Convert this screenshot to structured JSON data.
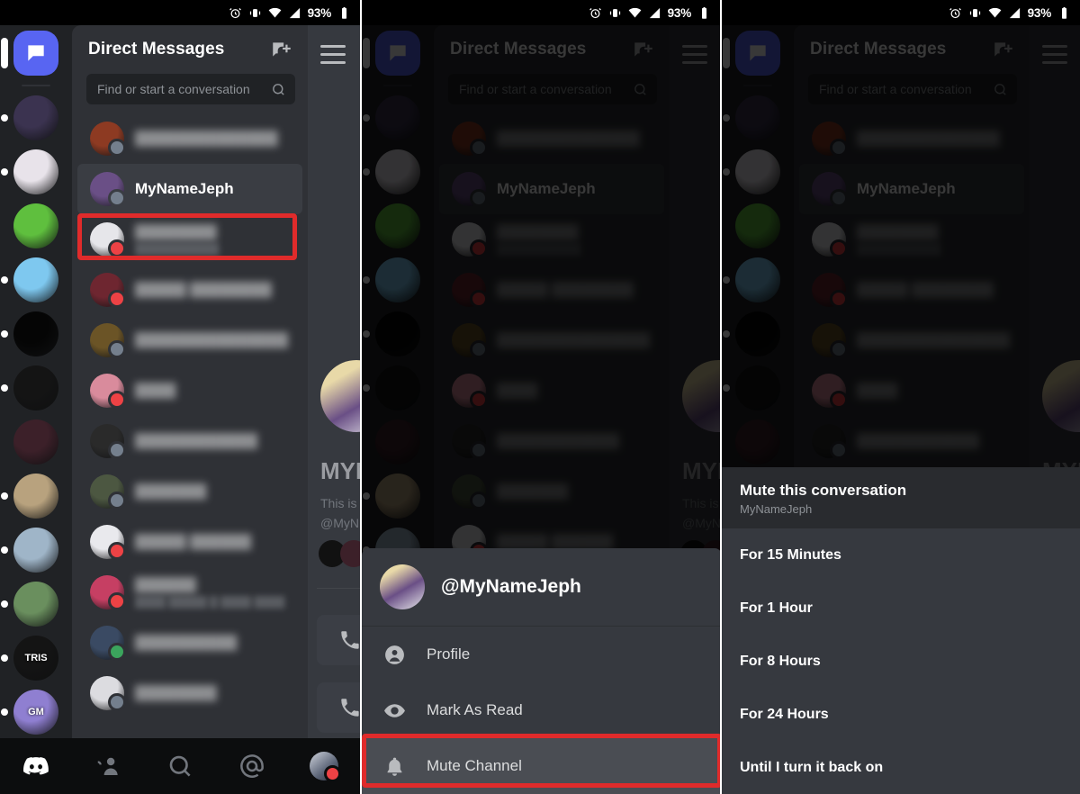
{
  "status_bar": {
    "battery_percent": "93%",
    "icons": [
      "alarm-clock-icon",
      "vibrate-icon",
      "wifi-icon",
      "cell-signal-icon",
      "battery-icon"
    ]
  },
  "app": {
    "name": "Discord",
    "dm_header_title": "Direct Messages",
    "new_dm_icon": "new-message-icon",
    "search_placeholder": "Find or start a conversation",
    "search_icon": "search-icon",
    "hamburger_icon": "hamburger-menu-icon"
  },
  "guild_rail": {
    "items": [
      {
        "name": "direct-messages",
        "type": "dm",
        "color": "#5865f2",
        "unread": true
      },
      {
        "name": "server-1",
        "color": "#3b3350",
        "unread": true
      },
      {
        "name": "server-2",
        "color": "#e8e3ea",
        "unread": true
      },
      {
        "name": "server-3",
        "color": "#5fbf3e",
        "unread": false
      },
      {
        "name": "server-4",
        "color": "#7ec8ef",
        "unread": true
      },
      {
        "name": "server-5",
        "color": "#050505",
        "unread": true
      },
      {
        "name": "server-6",
        "color": "#141414",
        "unread": true
      },
      {
        "name": "server-7",
        "color": "#3c2029",
        "unread": false
      },
      {
        "name": "server-8",
        "color": "#b8a27e",
        "unread": true
      },
      {
        "name": "server-9",
        "color": "#9fb5c8",
        "unread": true
      },
      {
        "name": "server-10",
        "color": "#6a8f5e",
        "unread": true
      },
      {
        "name": "server-11",
        "color": "#141414",
        "unread": true,
        "label": "TRIS"
      },
      {
        "name": "server-12",
        "color": "#8f7fd1",
        "unread": true,
        "label": "GM"
      }
    ]
  },
  "dm_list": {
    "items": [
      {
        "name": "dm-blurred-1",
        "title": "██████████████",
        "subtitle": "",
        "status": "offline",
        "blurred": true,
        "avatar": "#8d3a22"
      },
      {
        "name": "dm-mynamejeph",
        "title": "MyNameJeph",
        "subtitle": "",
        "status": "offline",
        "blurred": false,
        "selected": true,
        "avatar": "#6a4f86"
      },
      {
        "name": "dm-blurred-2",
        "title": "████████",
        "subtitle": "███████████",
        "status": "dnd",
        "blurred": true,
        "avatar": "#e6e6ea"
      },
      {
        "name": "dm-blurred-3",
        "title": "█████ ████████",
        "subtitle": "",
        "status": "dnd",
        "blurred": true,
        "avatar": "#6e2630"
      },
      {
        "name": "dm-blurred-4",
        "title": "███████████████",
        "subtitle": "",
        "status": "offline",
        "blurred": true,
        "avatar": "#6b5426"
      },
      {
        "name": "dm-blurred-5",
        "title": "████",
        "subtitle": "",
        "status": "dnd",
        "blurred": true,
        "avatar": "#d98b9c"
      },
      {
        "name": "dm-blurred-6",
        "title": "████████████",
        "subtitle": "",
        "status": "offline",
        "blurred": true,
        "avatar": "#2a2a2a"
      },
      {
        "name": "dm-blurred-7",
        "title": "███████",
        "subtitle": "",
        "status": "offline",
        "blurred": true,
        "avatar": "#4c5741"
      },
      {
        "name": "dm-blurred-8",
        "title": "█████ ██████",
        "subtitle": "",
        "status": "dnd",
        "blurred": true,
        "avatar": "#e9e9ed"
      },
      {
        "name": "dm-blurred-9",
        "title": "██████",
        "subtitle": "████ █████ █ ████ ████",
        "status": "dnd",
        "blurred": true,
        "avatar": "#c63f63"
      },
      {
        "name": "dm-blurred-10",
        "title": "██████████",
        "subtitle": "",
        "status": "online",
        "blurred": true,
        "avatar": "#3a4a63"
      },
      {
        "name": "dm-blurred-11",
        "title": "████████",
        "subtitle": "",
        "status": "offline",
        "blurred": true,
        "avatar": "#dcdce0"
      }
    ]
  },
  "chat_peek": {
    "heading": "MYN",
    "line1": "This is",
    "line2": "@MyN",
    "hamburger_icon": "hamburger-menu-icon",
    "call_icon": "phone-call-icon"
  },
  "tab_bar": {
    "items": [
      {
        "name": "tab-home",
        "icon": "discord-logo-icon"
      },
      {
        "name": "tab-friends",
        "icon": "friends-icon"
      },
      {
        "name": "tab-search",
        "icon": "search-icon"
      },
      {
        "name": "tab-mentions",
        "icon": "mentions-at-icon"
      },
      {
        "name": "tab-profile",
        "icon": "user-avatar-icon"
      }
    ]
  },
  "action_sheet": {
    "username": "@MyNameJeph",
    "items": [
      {
        "name": "sheet-item-profile",
        "label": "Profile",
        "icon": "person-icon",
        "highlighted": false
      },
      {
        "name": "sheet-item-mark-as-read",
        "label": "Mark As Read",
        "icon": "eye-icon",
        "highlighted": false
      },
      {
        "name": "sheet-item-mute-channel",
        "label": "Mute Channel",
        "icon": "bell-icon",
        "highlighted": true
      }
    ]
  },
  "mute_sheet": {
    "title": "Mute this conversation",
    "subtitle": "MyNameJeph",
    "options": [
      {
        "name": "mute-option-15-minutes",
        "label": "For 15 Minutes"
      },
      {
        "name": "mute-option-1-hour",
        "label": "For 1 Hour"
      },
      {
        "name": "mute-option-8-hours",
        "label": "For 8 Hours"
      },
      {
        "name": "mute-option-24-hours",
        "label": "For 24 Hours"
      },
      {
        "name": "mute-option-until-turned-back-on",
        "label": "Until I turn it back on"
      }
    ]
  },
  "annotations": {
    "highlight_color": "#e02b2b",
    "boxes": [
      {
        "name": "highlight-mynamejeph-dm-row",
        "panel": 1
      },
      {
        "name": "highlight-mute-channel-item",
        "panel": 2
      }
    ]
  }
}
